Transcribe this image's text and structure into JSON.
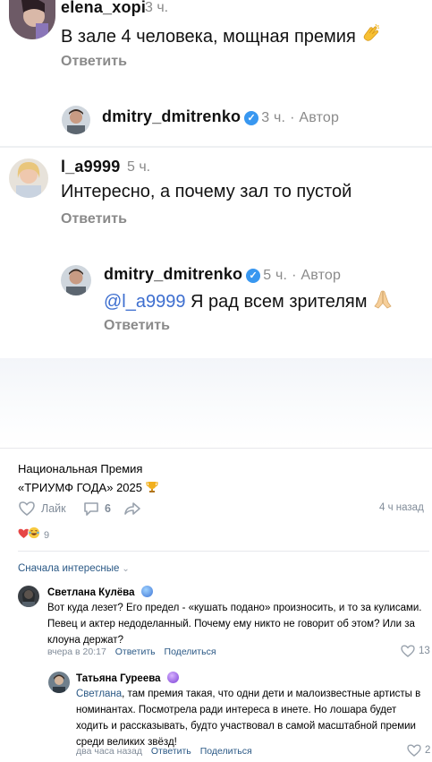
{
  "instagram": {
    "comments": [
      {
        "username": "elena_xopi",
        "time": "3 ч.",
        "text": "В зале  4 человека, мощная премия",
        "reply_label": "Ответить"
      },
      {
        "username": "dmitry_dmitrenko",
        "time": "3 ч.",
        "author_tag": "· Автор"
      },
      {
        "username": "l_a9999",
        "time": "5 ч.",
        "text": "Интересно, а почему зал то пустой",
        "reply_label": "Ответить"
      },
      {
        "username": "dmitry_dmitrenko",
        "time": "5 ч.",
        "author_tag": "· Автор",
        "mention": "@l_a9999",
        "text": " Я рад всем зрителям",
        "reply_label": "Ответить"
      }
    ],
    "colors": {
      "verified": "#3897f0",
      "mention": "#3d6ecf"
    }
  },
  "post": {
    "title_line1": "Национальная Премия",
    "title_line2": "«ТРИУМФ ГОДА» 2025",
    "title_icon": "trophy-icon",
    "like_label": "Лайк",
    "comments_count": "6",
    "time_ago": "4 ч назад",
    "reactions_count": "9",
    "sort_label": "Сначала интересные"
  },
  "vk_comments": [
    {
      "name": "Светлана Кулёва",
      "text": "Вот куда лезет? Его предел - «кушать подано» произносить, и то за кулисами. Певец и актер недоделанный. Почему ему никто не говорит об этом? Или за клоуна держат?",
      "time": "вчера в 20:17",
      "reply_label": "Ответить",
      "share_label": "Поделиться",
      "likes": "13"
    },
    {
      "name": "Татьяна Гуреева",
      "mention": "Светлана",
      "text": ", там премия такая, что одни дети и малоизвестные артисты в номинантах. Посмотрела ради интереса в инете. Но лошара будет ходить и рассказывать, будто участвовал в самой масштабной премии среди великих звёзд!",
      "time": "два часа назад",
      "reply_label": "Ответить",
      "share_label": "Поделиться",
      "likes": "2"
    }
  ],
  "colors": {
    "vk_link": "#2a5885",
    "vk_meta": "#818c99",
    "heart": "#e64646"
  }
}
